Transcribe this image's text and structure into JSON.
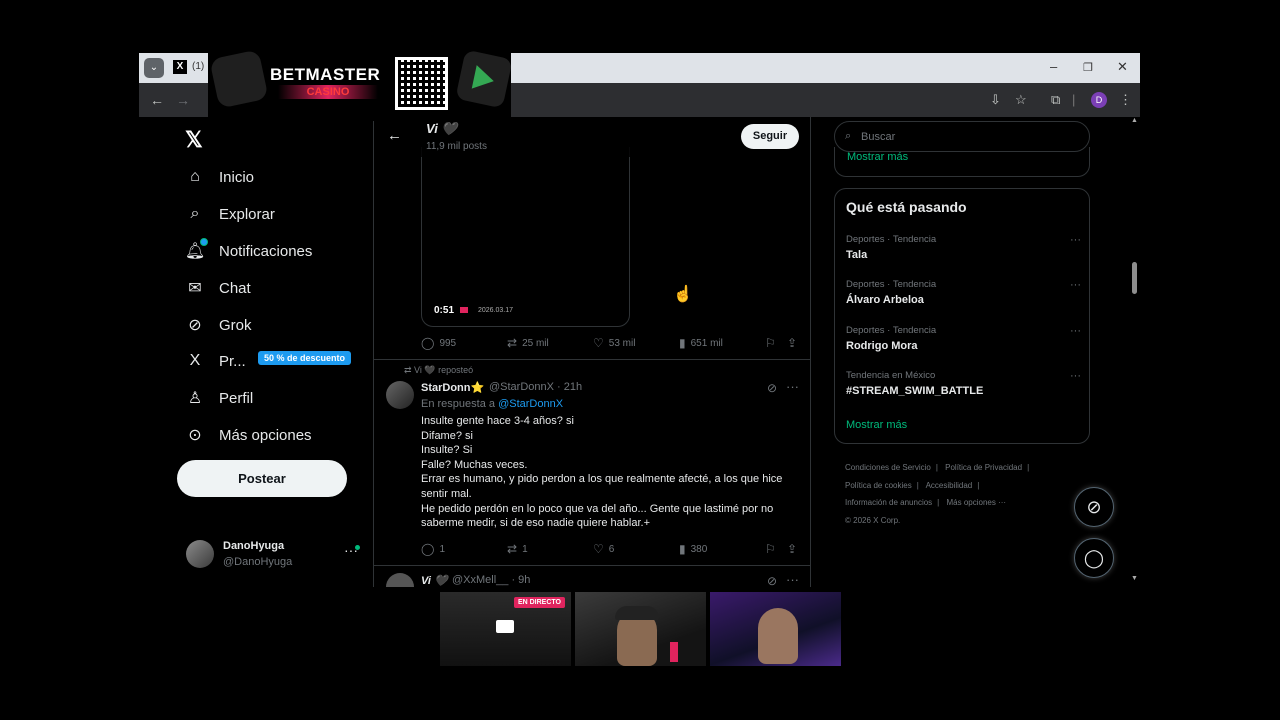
{
  "browser": {
    "tab_count": "(1)",
    "tab_icon": "x-logo",
    "menu_tab_toggle": "⌄"
  },
  "ad": {
    "brand": "BETMASTER",
    "sub": "CASINO",
    "icons": [
      "apple-icon",
      "qr-code",
      "google-play-icon"
    ]
  },
  "nav": {
    "items": [
      {
        "label": "Inicio",
        "icon": "home-icon"
      },
      {
        "label": "Explorar",
        "icon": "search-icon"
      },
      {
        "label": "Notificaciones",
        "icon": "bell-icon"
      },
      {
        "label": "Chat",
        "icon": "mail-icon"
      },
      {
        "label": "Grok",
        "icon": "grok-icon"
      },
      {
        "label": "Pr...",
        "icon": "x-icon"
      },
      {
        "label": "Perfil",
        "icon": "person-icon"
      },
      {
        "label": "Más opciones",
        "icon": "more-icon"
      }
    ],
    "promo_badge": "50 % de descuento",
    "post_button": "Postear",
    "user": {
      "name": "DanoHyuga",
      "handle": "@DanoHyuga"
    }
  },
  "header": {
    "profile_name": "Vi 🖤",
    "posts_count": "11,9 mil posts",
    "follow_button": "Seguir"
  },
  "video_post": {
    "duration": "0:51",
    "date": "2026.03.17",
    "replies": "995",
    "reposts": "25 mil",
    "likes": "53 mil",
    "views": "651 mil"
  },
  "tweet": {
    "repost_line": "Vi 🖤 reposteó",
    "author_name": "StarDonn⭐",
    "author_meta": "@StarDonnX · 21h",
    "reply_prefix": "En respuesta a",
    "reply_to": "@StarDonnX",
    "lines": [
      "Insulte gente hace 3-4 años? si",
      "Difame? si",
      "Insulte? Si",
      "Falle? Muchas veces.",
      "Errar es humano, y pido perdon a los que realmente afecté, a los que hice sentir mal.",
      "He pedido perdón en lo poco que va del año... Gente que lastimé por no saberme medir, si de eso nadie quiere hablar.+"
    ],
    "replies": "1",
    "reposts": "1",
    "likes": "6",
    "views": "380"
  },
  "tweet2": {
    "author_name": "Vi 🖤",
    "author_meta": "@XxMell__ · 9h"
  },
  "search": {
    "placeholder": "Buscar"
  },
  "prev_show_more": "Mostrar más",
  "trends": {
    "title": "Qué está pasando",
    "items": [
      {
        "category": "Deportes · Tendencia",
        "name": "Tala"
      },
      {
        "category": "Deportes · Tendencia",
        "name": "Álvaro Arbeloa"
      },
      {
        "category": "Deportes · Tendencia",
        "name": "Rodrigo Mora"
      },
      {
        "category": "Tendencia en México",
        "name": "#STREAM_SWIM_BATTLE"
      }
    ],
    "show_more": "Mostrar más"
  },
  "footer": {
    "links": [
      "Condiciones de Servicio",
      "Política de Privacidad",
      "Política de cookies",
      "Accesibilidad",
      "Información de anuncios",
      "Más opciones ···"
    ],
    "copyright": "© 2026 X Corp."
  },
  "stream": {
    "live_badge": "EN DIRECTO"
  },
  "colors": {
    "accent_blue": "#1d9bf0",
    "link_green": "#00ba7c",
    "background": "#000000",
    "text": "#e7e9ea",
    "muted": "#71767b"
  }
}
